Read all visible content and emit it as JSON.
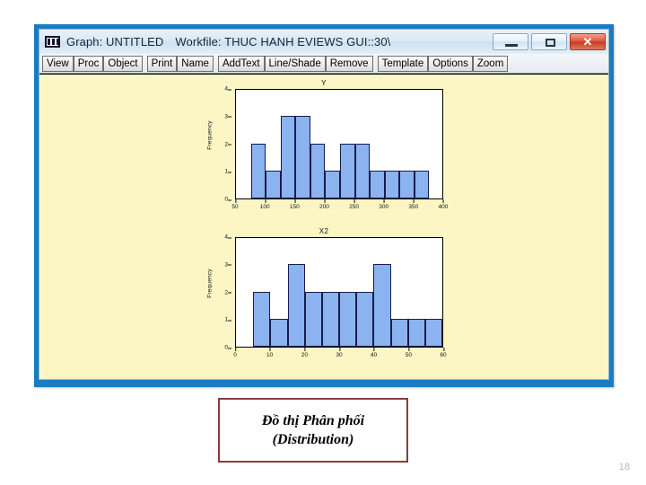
{
  "window": {
    "title_app": "Graph: UNTITLED",
    "title_workfile": "Workfile: THUC HANH EVIEWS GUI::30\\",
    "icon": "graph-window-icon",
    "controls": {
      "minimize": "minimize-button",
      "maximize": "maximize-button",
      "close_glyph": "✕"
    },
    "frame_color": "#1a7cc0",
    "canvas_color": "#fbf6c4"
  },
  "toolbar": {
    "groups": [
      [
        "View",
        "Proc",
        "Object"
      ],
      [
        "Print",
        "Name"
      ],
      [
        "AddText",
        "Line/Shade",
        "Remove"
      ],
      [
        "Template",
        "Options",
        "Zoom"
      ]
    ]
  },
  "chart_data": [
    {
      "type": "bar",
      "title": "Y",
      "xlabel": "",
      "ylabel": "Frequency",
      "ylim": [
        0,
        4
      ],
      "yticks": [
        0,
        1,
        2,
        3,
        4
      ],
      "xlim": [
        50,
        400
      ],
      "xticks": [
        50,
        100,
        150,
        200,
        250,
        300,
        350,
        400
      ],
      "bin_edges": [
        75,
        100,
        125,
        150,
        175,
        200,
        225,
        250,
        275,
        300,
        325,
        350,
        375
      ],
      "values": [
        2,
        1,
        3,
        3,
        2,
        1,
        2,
        2,
        1,
        1,
        1,
        1
      ],
      "bar_fill": "#8ab3ef",
      "bar_edge": "#1a1a4d",
      "grid": false,
      "legend": false
    },
    {
      "type": "bar",
      "title": "X2",
      "xlabel": "",
      "ylabel": "Frequency",
      "ylim": [
        0,
        4
      ],
      "yticks": [
        0,
        1,
        2,
        3,
        4
      ],
      "xlim": [
        0,
        60
      ],
      "xticks": [
        0,
        10,
        20,
        30,
        40,
        50,
        60
      ],
      "bin_edges": [
        5,
        10,
        15,
        20,
        25,
        30,
        35,
        40,
        45,
        50,
        55,
        60
      ],
      "values": [
        2,
        1,
        3,
        2,
        2,
        2,
        2,
        3,
        1,
        1,
        1
      ],
      "bar_fill": "#8ab3ef",
      "bar_edge": "#1a1a4d",
      "grid": false,
      "legend": false
    }
  ],
  "caption": {
    "line1": "Đồ thị Phân phối",
    "line2": "(Distribution)",
    "border_color": "#8b3a3a"
  },
  "page_number": "18"
}
